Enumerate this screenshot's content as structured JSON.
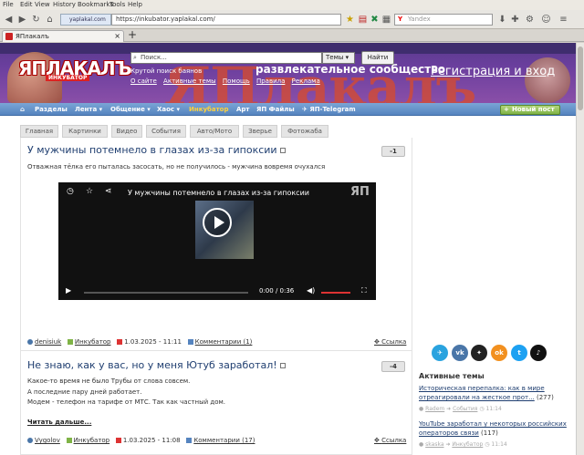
{
  "browser": {
    "menu": [
      "File",
      "Edit",
      "View",
      "History",
      "Bookmarks",
      "Tools",
      "Help"
    ],
    "site_identity": "yaplakal.com",
    "url": "https://inkubator.yaplakal.com/",
    "search_engine": "Y",
    "search_placeholder": "Yandex",
    "tab_title": "ЯПлакалъ",
    "tab_close": "×",
    "new_tab": "+"
  },
  "banner": {
    "logo_main": "ЯПЛАКАЛЪ",
    "logo_sub": "ИНКУБАТОР",
    "big_text": "ЯПлакалъ",
    "search_placeholder": "Поиск...",
    "search_scope": "Темы",
    "search_button": "Найти",
    "tagline": "Крутой поиск баянов",
    "quick_links": [
      "О сайте",
      "Активные темы",
      "Помощь",
      "Правила",
      "Реклама"
    ],
    "slogan": "развлекательное сообщество",
    "register": "Регистрация и вход"
  },
  "nav": {
    "items": [
      "Разделы",
      "Лента",
      "Общение",
      "Хаос",
      "Инкубатор",
      "Арт",
      "ЯП Файлы",
      "ЯП-Telegram"
    ],
    "new_post": "Новый пост"
  },
  "categories": [
    "Главная",
    "Картинки",
    "Видео",
    "События",
    "Авто/Мото",
    "Зверье",
    "Фотожаба"
  ],
  "posts": [
    {
      "title": "У мужчины потемнело в глазах из-за гипоксии",
      "score": "-1",
      "subtitle": "Отважная тёлка его пыталась засосать, но не получилось - мужчина вовремя очухался",
      "video": {
        "title": "У мужчины потемнело в глазах из-за гипоксии",
        "time": "0:00 / 0:36",
        "watermark": "ЯП"
      },
      "author": "denisiuk",
      "section": "Инкубатор",
      "date": "1.03.2025 - 11:11",
      "comments": "Комментарии (1)",
      "share": "Ссылка"
    },
    {
      "title": "Не знаю, как у вас, но у меня Ютуб заработал!",
      "score": "-4",
      "lines": [
        "Какое-то время не было Трубы от слова совсем.",
        "А последние пару дней работает.",
        "Модем - телефон на тарифе от МТС. Так как частный дом."
      ],
      "read_more": "Читать дальше...",
      "author": "Vygolov",
      "section": "Инкубатор",
      "date": "1.03.2025 - 11:08",
      "comments": "Комментарии (17)",
      "share": "Ссылка"
    }
  ],
  "sidebar": {
    "social": [
      {
        "name": "telegram",
        "color": "#2aa3df",
        "glyph": "✈"
      },
      {
        "name": "vk",
        "color": "#4a76a8",
        "glyph": "vk"
      },
      {
        "name": "dzen",
        "color": "#222222",
        "glyph": "✦"
      },
      {
        "name": "ok",
        "color": "#f2901f",
        "glyph": "ok"
      },
      {
        "name": "twitter",
        "color": "#1da1f2",
        "glyph": "t"
      },
      {
        "name": "tiktok",
        "color": "#111111",
        "glyph": "♪"
      }
    ],
    "active_title": "Активные темы",
    "topics": [
      {
        "title": "Историческая перепалка: как в мире отреагировали на жесткое прот...",
        "count": "(277)",
        "author": "Radem",
        "section": "События",
        "time": "11:14"
      },
      {
        "title": "YouTube заработал у некоторых российских операторов связи",
        "count": "(117)",
        "author": "skaska",
        "section": "Инкубатор",
        "time": "11:14"
      }
    ]
  },
  "colors": {
    "nav_blue": "#5584bf",
    "title_blue": "#1f3e70",
    "active_nav": "#ffd23c",
    "new_post_green": "#7fb346"
  }
}
